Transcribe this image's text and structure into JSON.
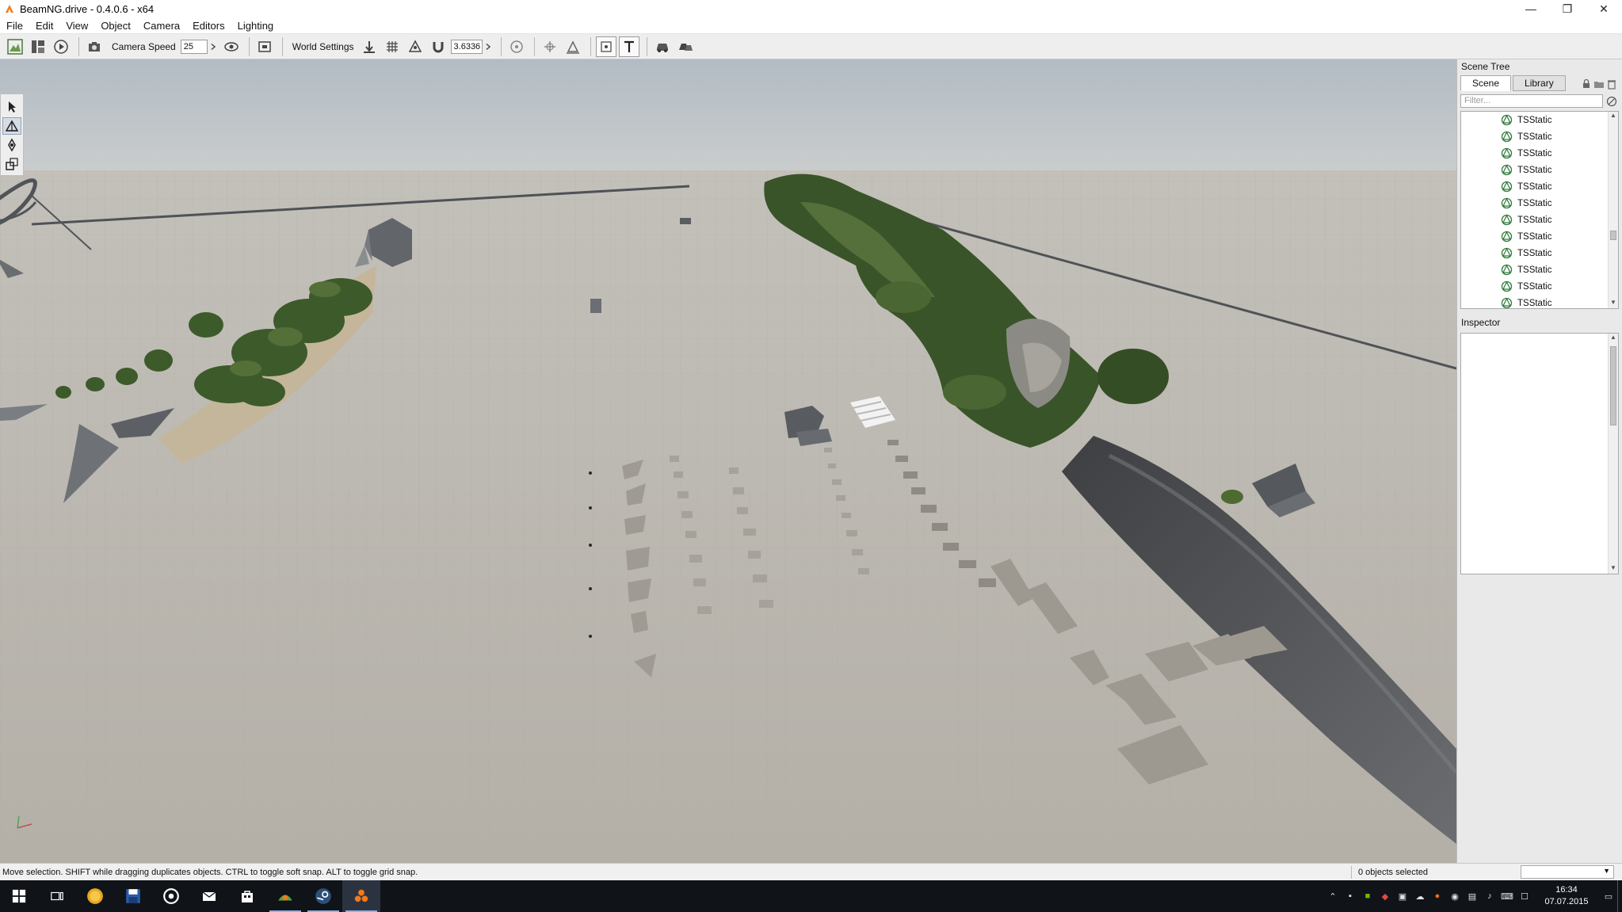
{
  "window": {
    "title": "BeamNG.drive - 0.4.0.6 - x64",
    "controls": [
      "—",
      "❐",
      "✕"
    ]
  },
  "menu": [
    "File",
    "Edit",
    "View",
    "Object",
    "Camera",
    "Editors",
    "Lighting"
  ],
  "toolbar": {
    "camera_speed_label": "Camera Speed",
    "camera_speed_value": "25",
    "world_settings_label": "World Settings",
    "snap_value": "3.6336"
  },
  "scene_tree": {
    "title": "Scene Tree",
    "tabs": [
      "Scene",
      "Library"
    ],
    "active_tab": "Scene",
    "filter_placeholder": "Filter...",
    "items": [
      "TSStatic",
      "TSStatic",
      "TSStatic",
      "TSStatic",
      "TSStatic",
      "TSStatic",
      "TSStatic",
      "TSStatic",
      "TSStatic",
      "TSStatic",
      "TSStatic",
      "TSStatic"
    ]
  },
  "inspector": {
    "title": "Inspector"
  },
  "status": {
    "message": "Move selection.  SHIFT while dragging duplicates objects.  CTRL to toggle soft snap.  ALT to toggle grid snap.",
    "selection": "0 objects selected"
  },
  "taskbar": {
    "time": "16:34",
    "date": "07.07.2015"
  },
  "colors": {
    "ground": "#b7b3ab",
    "sky": "#c9ccce",
    "foliage": "#3e5a2b",
    "rock": "#4c4f52",
    "taskbar": "#101318"
  }
}
